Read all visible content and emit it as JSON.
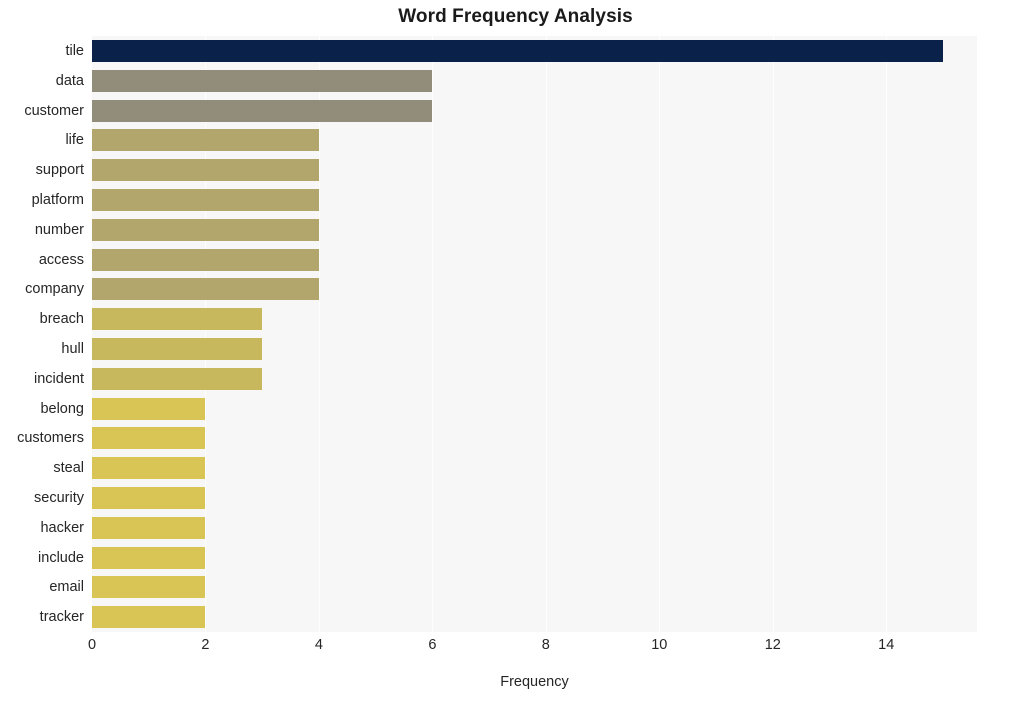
{
  "chart_data": {
    "type": "bar",
    "orientation": "horizontal",
    "title": "Word Frequency Analysis",
    "xlabel": "Frequency",
    "ylabel": "",
    "xlim": [
      0,
      15.6
    ],
    "ylim": [
      0,
      20
    ],
    "grid": true,
    "legend": null,
    "x_ticks": [
      0,
      2,
      4,
      6,
      8,
      10,
      12,
      14
    ],
    "x_tick_labels": [
      "0",
      "2",
      "4",
      "6",
      "8",
      "10",
      "12",
      "14"
    ],
    "categories": [
      "tile",
      "data",
      "customer",
      "life",
      "support",
      "platform",
      "number",
      "access",
      "company",
      "breach",
      "hull",
      "incident",
      "belong",
      "customers",
      "steal",
      "security",
      "hacker",
      "include",
      "email",
      "tracker"
    ],
    "values": [
      15,
      6,
      6,
      4,
      4,
      4,
      4,
      4,
      4,
      3,
      3,
      3,
      2,
      2,
      2,
      2,
      2,
      2,
      2,
      2
    ],
    "bar_colors": [
      "#0a2249",
      "#918d7a",
      "#918d7a",
      "#b3a66d",
      "#b3a66d",
      "#b3a66d",
      "#b3a66d",
      "#b3a66d",
      "#b3a66d",
      "#c7b85e",
      "#c7b85e",
      "#c7b85e",
      "#d9c456",
      "#d9c456",
      "#d9c456",
      "#d9c456",
      "#d9c456",
      "#d9c456",
      "#d9c456",
      "#d9c456"
    ],
    "plot_background": "#f7f7f7",
    "figure_background": "#ffffff",
    "gridline_color": "#ffffff",
    "text_color": "#262626"
  }
}
